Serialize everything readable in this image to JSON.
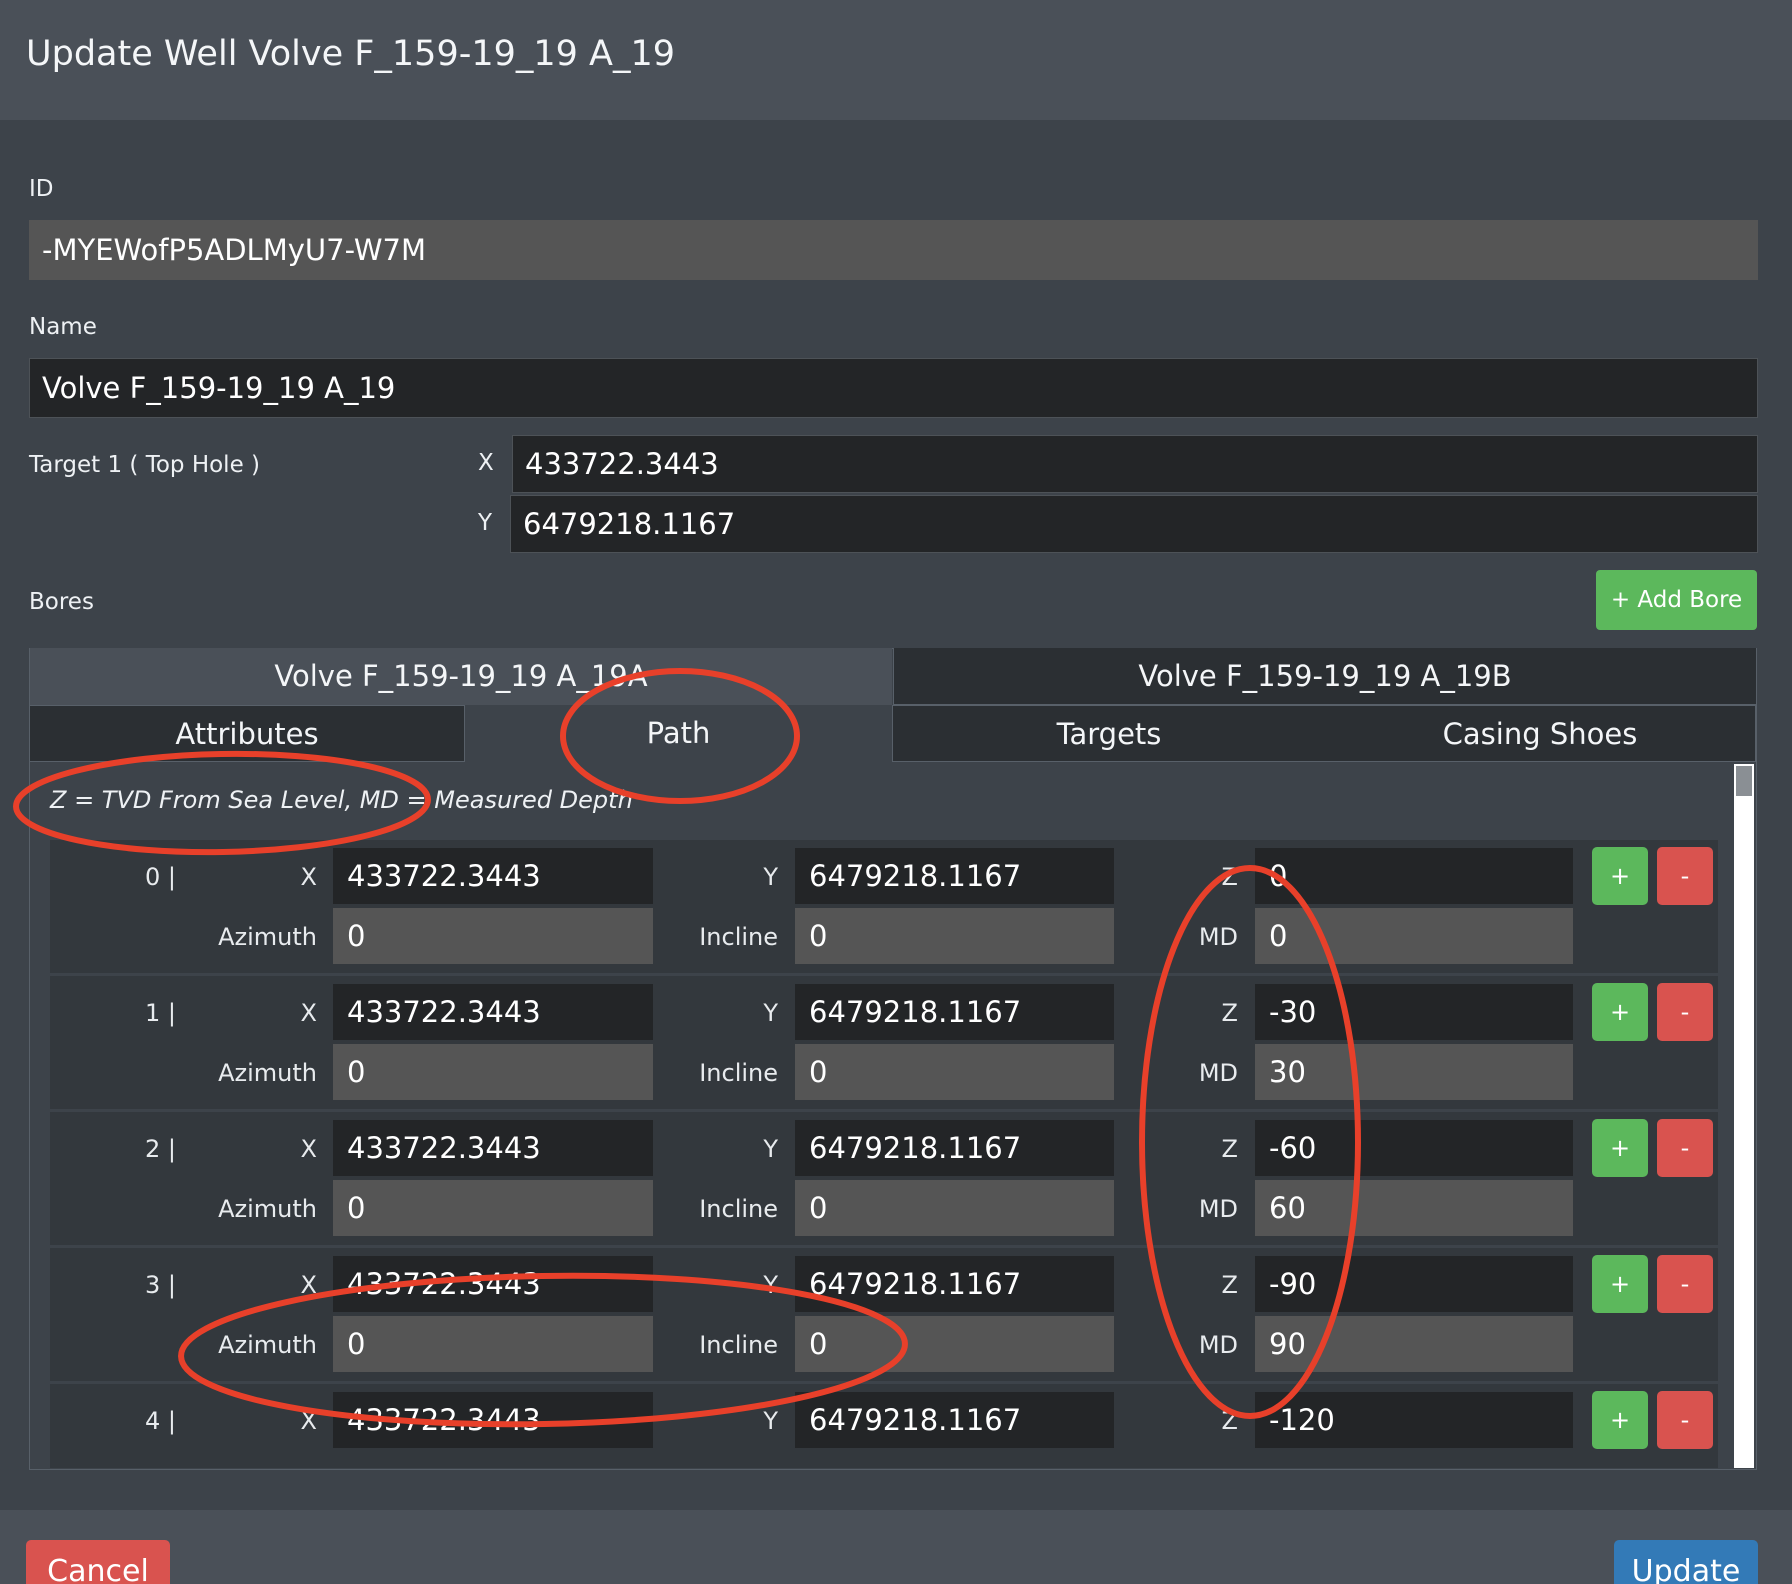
{
  "dialog": {
    "title": "Update Well Volve F_159-19_19 A_19"
  },
  "form": {
    "id_label": "ID",
    "id_value": "-MYEWofP5ADLMyU7-W7M",
    "name_label": "Name",
    "name_value": "Volve F_159-19_19 A_19",
    "target_label": "Target 1 ( Top Hole )",
    "target_x_label": "X",
    "target_x_value": "433722.3443",
    "target_y_label": "Y",
    "target_y_value": "6479218.1167",
    "bores_label": "Bores",
    "add_bore_label": "+ Add Bore"
  },
  "bore_tabs": [
    "Volve F_159-19_19 A_19A",
    "Volve F_159-19_19 A_19B"
  ],
  "sub_tabs": [
    "Attributes",
    "Path",
    "Targets",
    "Casing Shoes"
  ],
  "path": {
    "note": "Z = TVD From Sea Level, MD = Measured Depth",
    "labels": {
      "x": "X",
      "y": "Y",
      "z": "Z",
      "azimuth": "Azimuth",
      "incline": "Incline",
      "md": "MD"
    },
    "rows": [
      {
        "index": "0 |",
        "x": "433722.3443",
        "y": "6479218.1167",
        "z": "0",
        "azimuth": "0",
        "incline": "0",
        "md": "0"
      },
      {
        "index": "1 |",
        "x": "433722.3443",
        "y": "6479218.1167",
        "z": "-30",
        "azimuth": "0",
        "incline": "0",
        "md": "30"
      },
      {
        "index": "2 |",
        "x": "433722.3443",
        "y": "6479218.1167",
        "z": "-60",
        "azimuth": "0",
        "incline": "0",
        "md": "60"
      },
      {
        "index": "3 |",
        "x": "433722.3443",
        "y": "6479218.1167",
        "z": "-90",
        "azimuth": "0",
        "incline": "0",
        "md": "90"
      },
      {
        "index": "4 |",
        "x": "433722.3443",
        "y": "6479218.1167",
        "z": "-120"
      }
    ],
    "add_label": "+",
    "remove_label": "-"
  },
  "footer": {
    "cancel_label": "Cancel",
    "update_label": "Update"
  },
  "colors": {
    "add": "#5cb85c",
    "remove": "#d9534f",
    "update": "#337ab7",
    "annotation": "#e8402a"
  }
}
